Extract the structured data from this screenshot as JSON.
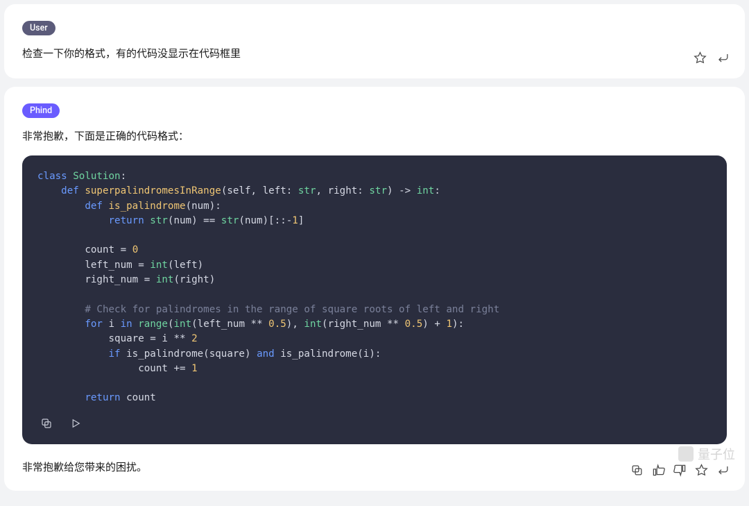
{
  "user": {
    "badge": "User",
    "message": "检查一下你的格式，有的代码没显示在代码框里"
  },
  "phind": {
    "badge": "Phind",
    "intro": "非常抱歉，下面是正确的代码格式：",
    "footer": "非常抱歉给您带来的困扰。"
  },
  "code": {
    "lines": [
      {
        "indent": 0,
        "tokens": [
          {
            "t": "class ",
            "c": "kw"
          },
          {
            "t": "Solution",
            "c": "cls"
          },
          {
            "t": ":",
            "c": "op"
          }
        ]
      },
      {
        "indent": 1,
        "tokens": [
          {
            "t": "def ",
            "c": "kw"
          },
          {
            "t": "superpalindromesInRange",
            "c": "fn"
          },
          {
            "t": "(",
            "c": "op"
          },
          {
            "t": "self",
            "c": "self"
          },
          {
            "t": ", left: ",
            "c": "op"
          },
          {
            "t": "str",
            "c": "type"
          },
          {
            "t": ", right: ",
            "c": "op"
          },
          {
            "t": "str",
            "c": "type"
          },
          {
            "t": ") -> ",
            "c": "op"
          },
          {
            "t": "int",
            "c": "type"
          },
          {
            "t": ":",
            "c": "op"
          }
        ]
      },
      {
        "indent": 2,
        "tokens": [
          {
            "t": "def ",
            "c": "kw"
          },
          {
            "t": "is_palindrome",
            "c": "fn"
          },
          {
            "t": "(num):",
            "c": "op"
          }
        ]
      },
      {
        "indent": 3,
        "tokens": [
          {
            "t": "return ",
            "c": "kw"
          },
          {
            "t": "str",
            "c": "builtin"
          },
          {
            "t": "(num) == ",
            "c": "op"
          },
          {
            "t": "str",
            "c": "builtin"
          },
          {
            "t": "(num)[::-",
            "c": "op"
          },
          {
            "t": "1",
            "c": "num"
          },
          {
            "t": "]",
            "c": "op"
          }
        ]
      },
      {
        "indent": 0,
        "tokens": []
      },
      {
        "indent": 2,
        "tokens": [
          {
            "t": "count = ",
            "c": "op"
          },
          {
            "t": "0",
            "c": "num"
          }
        ]
      },
      {
        "indent": 2,
        "tokens": [
          {
            "t": "left_num = ",
            "c": "op"
          },
          {
            "t": "int",
            "c": "builtin"
          },
          {
            "t": "(left)",
            "c": "op"
          }
        ]
      },
      {
        "indent": 2,
        "tokens": [
          {
            "t": "right_num = ",
            "c": "op"
          },
          {
            "t": "int",
            "c": "builtin"
          },
          {
            "t": "(right)",
            "c": "op"
          }
        ]
      },
      {
        "indent": 0,
        "tokens": []
      },
      {
        "indent": 2,
        "tokens": [
          {
            "t": "# Check for palindromes in the range of square roots of left and right",
            "c": "cmt"
          }
        ]
      },
      {
        "indent": 2,
        "tokens": [
          {
            "t": "for",
            "c": "kw"
          },
          {
            "t": " i ",
            "c": "op"
          },
          {
            "t": "in",
            "c": "kw"
          },
          {
            "t": " ",
            "c": "op"
          },
          {
            "t": "range",
            "c": "builtin"
          },
          {
            "t": "(",
            "c": "op"
          },
          {
            "t": "int",
            "c": "builtin"
          },
          {
            "t": "(left_num ** ",
            "c": "op"
          },
          {
            "t": "0.5",
            "c": "num"
          },
          {
            "t": "), ",
            "c": "op"
          },
          {
            "t": "int",
            "c": "builtin"
          },
          {
            "t": "(right_num ** ",
            "c": "op"
          },
          {
            "t": "0.5",
            "c": "num"
          },
          {
            "t": ") + ",
            "c": "op"
          },
          {
            "t": "1",
            "c": "num"
          },
          {
            "t": "):",
            "c": "op"
          }
        ]
      },
      {
        "indent": 3,
        "tokens": [
          {
            "t": "square = i ** ",
            "c": "op"
          },
          {
            "t": "2",
            "c": "num"
          }
        ]
      },
      {
        "indent": 3,
        "tokens": [
          {
            "t": "if",
            "c": "kw"
          },
          {
            "t": " is_palindrome(square) ",
            "c": "op"
          },
          {
            "t": "and",
            "c": "kw"
          },
          {
            "t": " is_palindrome(i):",
            "c": "op"
          }
        ]
      },
      {
        "indent": 4,
        "tokens": [
          {
            "t": " count += ",
            "c": "op"
          },
          {
            "t": "1",
            "c": "num"
          }
        ]
      },
      {
        "indent": 0,
        "tokens": []
      },
      {
        "indent": 2,
        "tokens": [
          {
            "t": "return",
            "c": "kw"
          },
          {
            "t": " count",
            "c": "op"
          }
        ]
      }
    ]
  },
  "watermark": "量子位"
}
